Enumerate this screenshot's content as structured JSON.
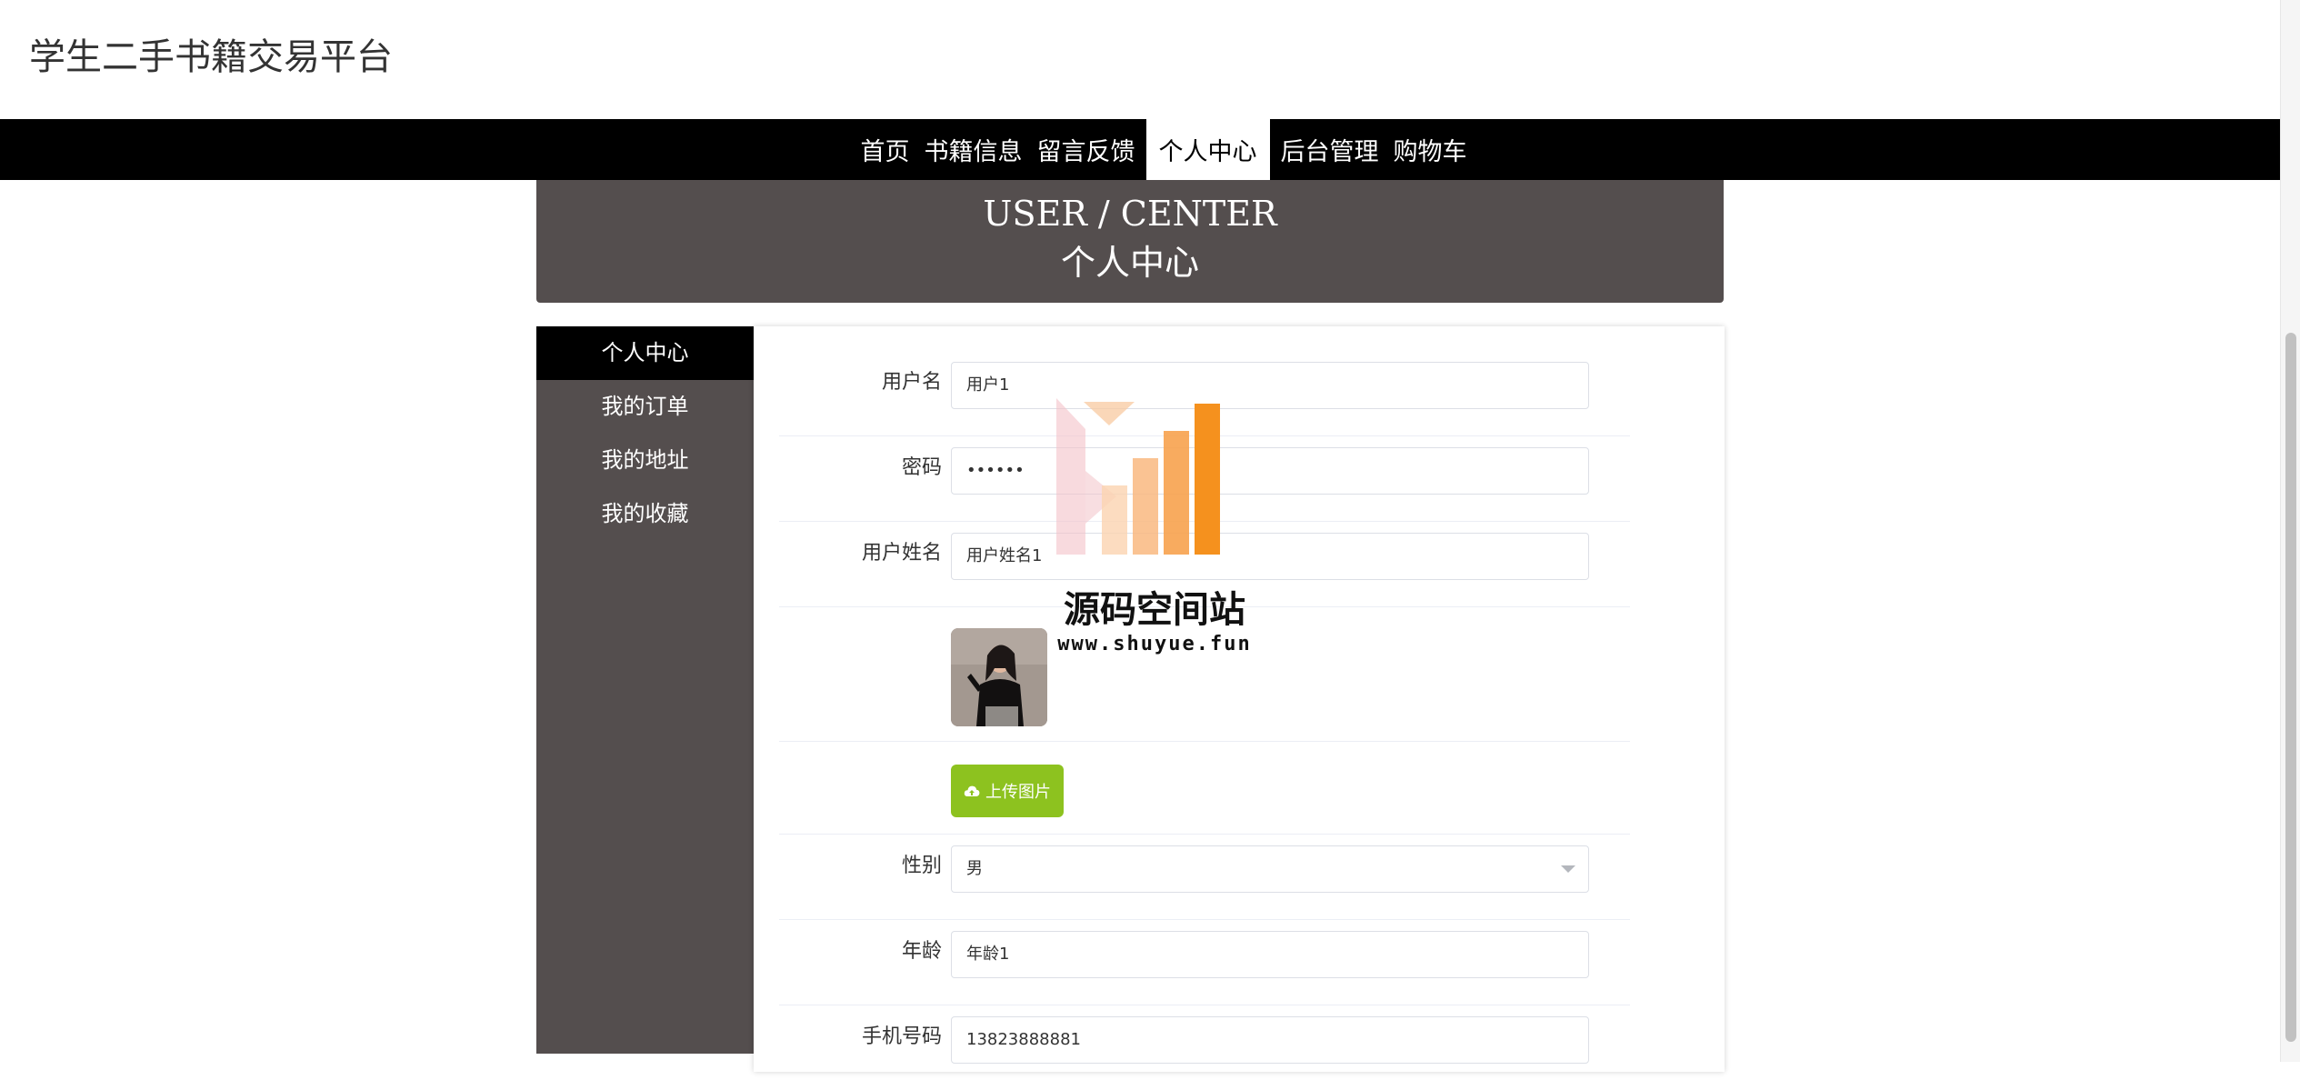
{
  "site": {
    "title": "学生二手书籍交易平台"
  },
  "nav": {
    "items": [
      "首页",
      "书籍信息",
      "留言反馈",
      "个人中心",
      "后台管理",
      "购物车"
    ],
    "active": "个人中心"
  },
  "banner": {
    "title_en": "USER / CENTER",
    "title_cn": "个人中心"
  },
  "side_menu": {
    "items": [
      "个人中心",
      "我的订单",
      "我的地址",
      "我的收藏"
    ],
    "active": "个人中心"
  },
  "form": {
    "username": {
      "label": "用户名",
      "value": "用户1"
    },
    "password": {
      "label": "密码",
      "value": "••••••"
    },
    "fullname": {
      "label": "用户姓名",
      "value": "用户姓名1"
    },
    "upload_label": "上传图片",
    "gender": {
      "label": "性别",
      "value": "男"
    },
    "age": {
      "label": "年龄",
      "value": "年龄1"
    },
    "phone": {
      "label": "手机号码",
      "value": "13823888881"
    }
  },
  "watermark": {
    "title": "源码空间站",
    "url": "www.shuyue.fun"
  },
  "colors": {
    "nav_bg": "#000000",
    "panel_bg": "#544e4e",
    "upload_button": "#8dc21f",
    "watermark_orange": "#f5911e"
  },
  "icons": {
    "upload": "cloud-upload-icon",
    "select_arrow": "chevron-down-icon"
  }
}
